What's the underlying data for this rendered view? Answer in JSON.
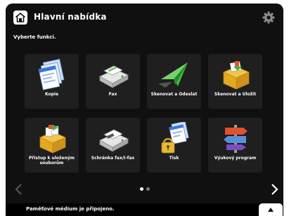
{
  "header": {
    "title": "Hlavní nabídka"
  },
  "subtitle": "Vyberte funkci.",
  "tiles": [
    {
      "label": "Kopie",
      "icon": "copy-icon"
    },
    {
      "label": "Fax",
      "icon": "fax-icon"
    },
    {
      "label": "Skenovat a Odeslat",
      "icon": "scan-and-send-icon"
    },
    {
      "label": "Skenovat a Uložit",
      "icon": "scan-and-store-icon"
    },
    {
      "label": "Přístup k uloženým souborům",
      "icon": "access-stored-files-icon"
    },
    {
      "label": "Schránka fax/I-fax",
      "icon": "fax-inbox-icon"
    },
    {
      "label": "Tisk",
      "icon": "print-icon"
    },
    {
      "label": "Výukový program",
      "icon": "tutorial-signpost-icon"
    }
  ],
  "pagination": {
    "current_page": 1,
    "total_pages": 2
  },
  "status_bar": {
    "message": "Paměťové médium je připojeno."
  },
  "colors": {
    "screen_background": "#101010",
    "tile_background": "#1f1f1f",
    "text": "#ffffff",
    "accent_green": "#35a82f"
  }
}
